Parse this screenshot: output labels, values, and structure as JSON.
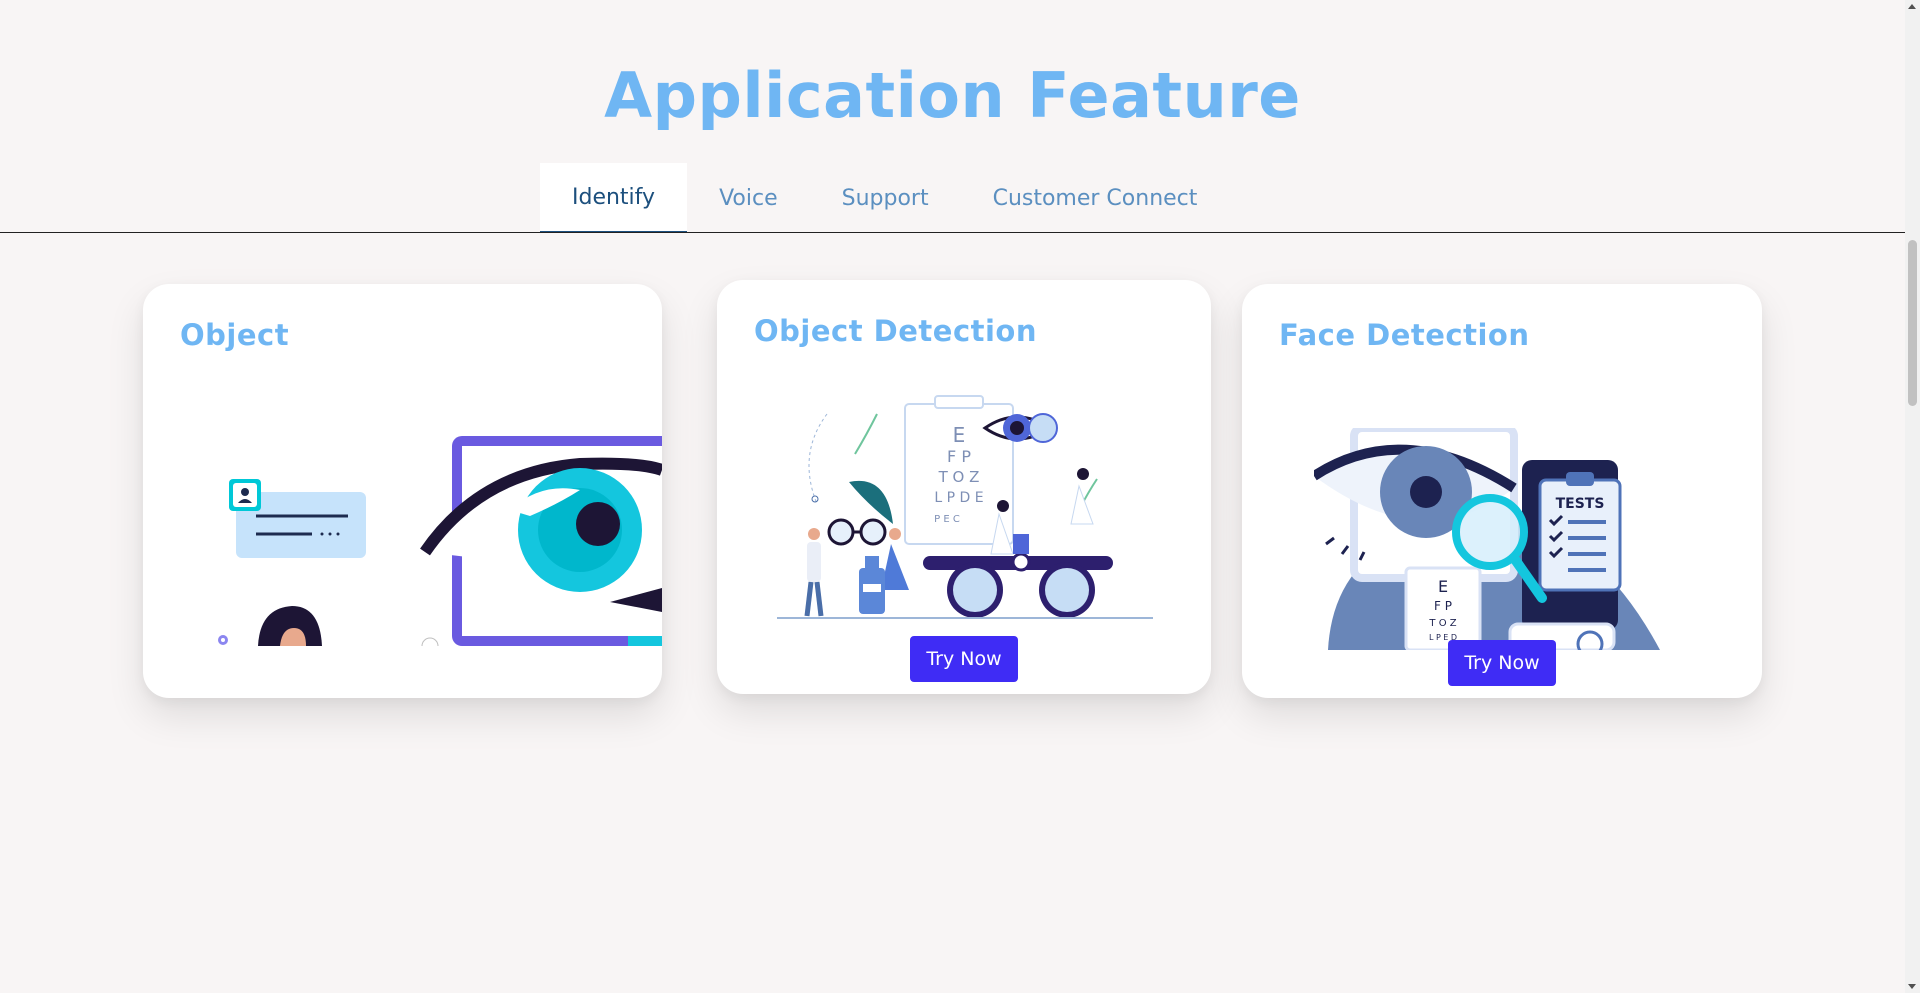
{
  "header": {
    "title": "Application Feature"
  },
  "tabs": [
    {
      "label": "Identify",
      "active": true
    },
    {
      "label": "Voice",
      "active": false
    },
    {
      "label": "Support",
      "active": false
    },
    {
      "label": "Customer Connect",
      "active": false
    }
  ],
  "cards": [
    {
      "title": "Object",
      "illustration": "eye-scan-illustration"
    },
    {
      "title": "Object Detection",
      "illustration": "eye-exam-illustration",
      "button_label": "Try Now"
    },
    {
      "title": "Face Detection",
      "illustration": "eye-test-magnifier-illustration",
      "button_label": "Try Now"
    }
  ],
  "colors": {
    "background": "#f8f5f5",
    "title": "#6fb6f3",
    "tab_inactive": "#5b8fc0",
    "tab_active": "#1c4f7d",
    "button": "#3f2cf5"
  }
}
